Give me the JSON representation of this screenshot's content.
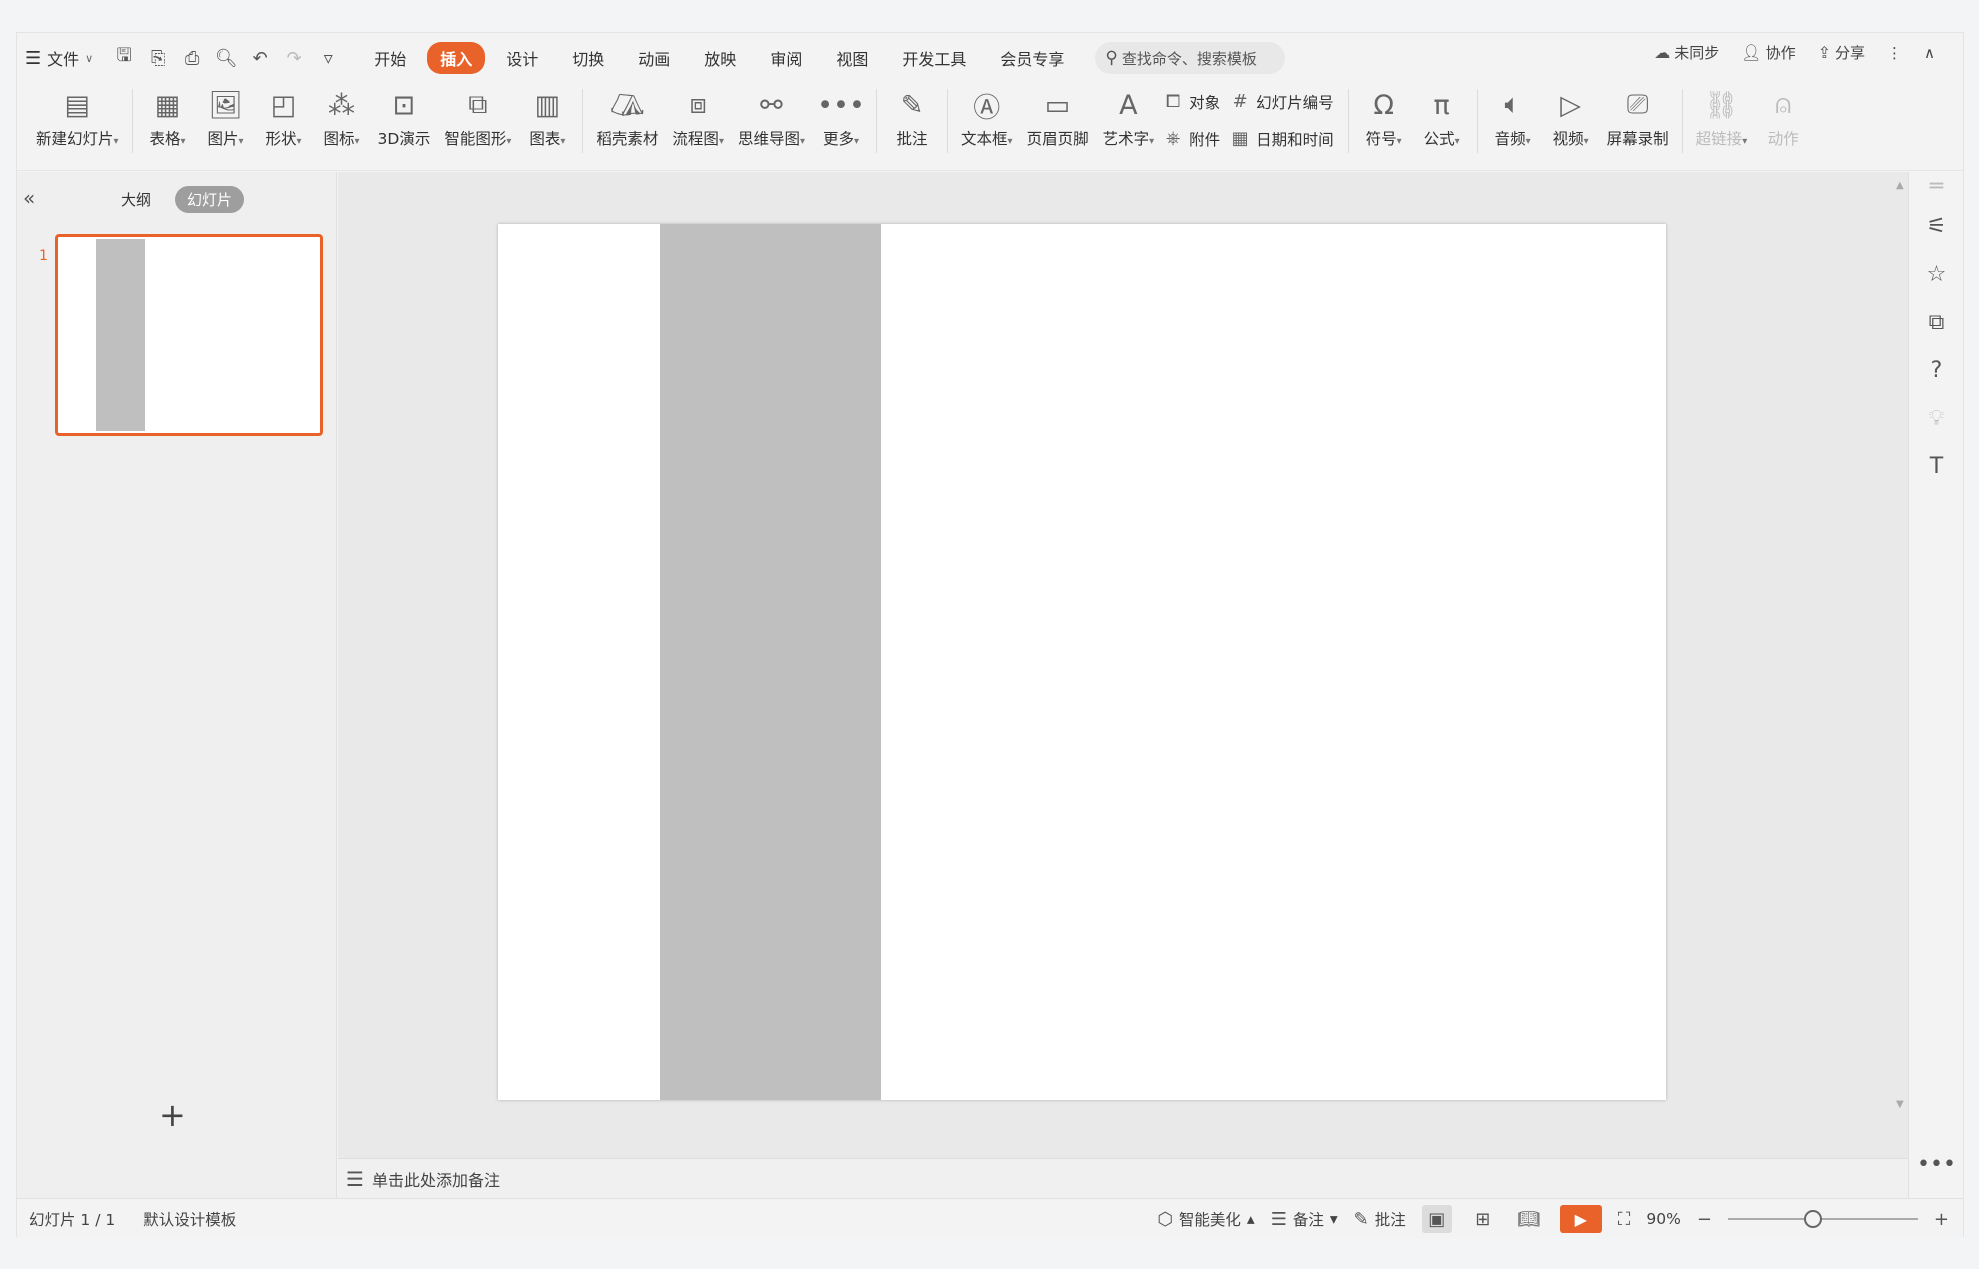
{
  "topbar": {
    "menu_label": "文件",
    "tabs": [
      {
        "label": "开始"
      },
      {
        "label": "插入",
        "active": true
      },
      {
        "label": "设计"
      },
      {
        "label": "切换"
      },
      {
        "label": "动画"
      },
      {
        "label": "放映"
      },
      {
        "label": "审阅"
      },
      {
        "label": "视图"
      },
      {
        "label": "开发工具"
      },
      {
        "label": "会员专享"
      }
    ],
    "search_placeholder": "查找命令、搜索模板",
    "sync_label": "未同步",
    "collab_label": "协作",
    "share_label": "分享"
  },
  "ribbon": {
    "new_slide": "新建幻灯片",
    "table": "表格",
    "picture": "图片",
    "shape": "形状",
    "icon": "图标",
    "three_d": "3D演示",
    "smart_art": "智能图形",
    "chart": "图表",
    "docer": "稻壳素材",
    "flowchart": "流程图",
    "mindmap": "思维导图",
    "more": "更多",
    "comment": "批注",
    "textbox": "文本框",
    "header_footer": "页眉页脚",
    "word_art": "艺术字",
    "object": "对象",
    "slide_number": "幻灯片编号",
    "attachment": "附件",
    "date_time": "日期和时间",
    "symbol": "符号",
    "formula": "公式",
    "audio": "音频",
    "video": "视频",
    "screen_record": "屏幕录制",
    "hyperlink": "超链接",
    "action": "动作"
  },
  "leftpanel": {
    "outline_tab": "大纲",
    "slides_tab": "幻灯片",
    "slide_number": "1"
  },
  "notes": {
    "placeholder": "单击此处添加备注"
  },
  "status": {
    "slide_count": "幻灯片 1 / 1",
    "template": "默认设计模板",
    "beautify": "智能美化",
    "notes": "备注",
    "comments": "批注",
    "zoom": "90%"
  },
  "colors": {
    "accent": "#e8622a",
    "slide_rect": "#bfbfbf"
  }
}
